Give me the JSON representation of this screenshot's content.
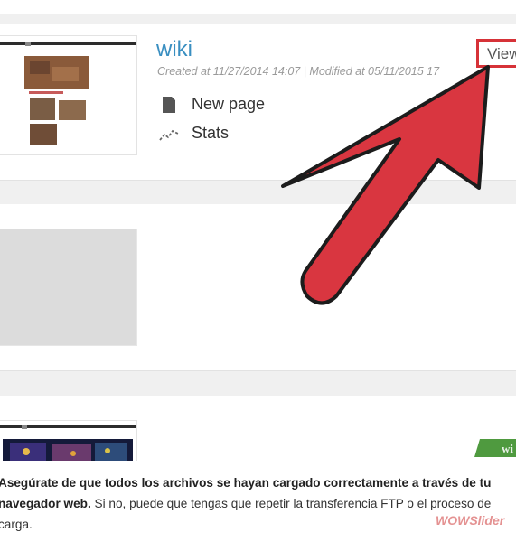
{
  "item": {
    "title": "wiki",
    "meta": "Created at 11/27/2014 14:07 | Modified at 05/11/2015 17",
    "actions": [
      {
        "label": "New page",
        "icon": "page-icon"
      },
      {
        "label": "Stats",
        "icon": "stats-icon"
      }
    ],
    "view_label": "View"
  },
  "badge": {
    "text": "wi"
  },
  "caption": {
    "bold": "Asegúrate de que todos los archivos se hayan cargado correctamente a través de tu navegador web.",
    "normal": " Si no, puede que tengas que repetir la transferencia FTP o el proceso de carga."
  },
  "watermark": "WOWSlider",
  "colors": {
    "title": "#3a8fc1",
    "arrow": "#d93640",
    "highlight": "#d63238"
  }
}
